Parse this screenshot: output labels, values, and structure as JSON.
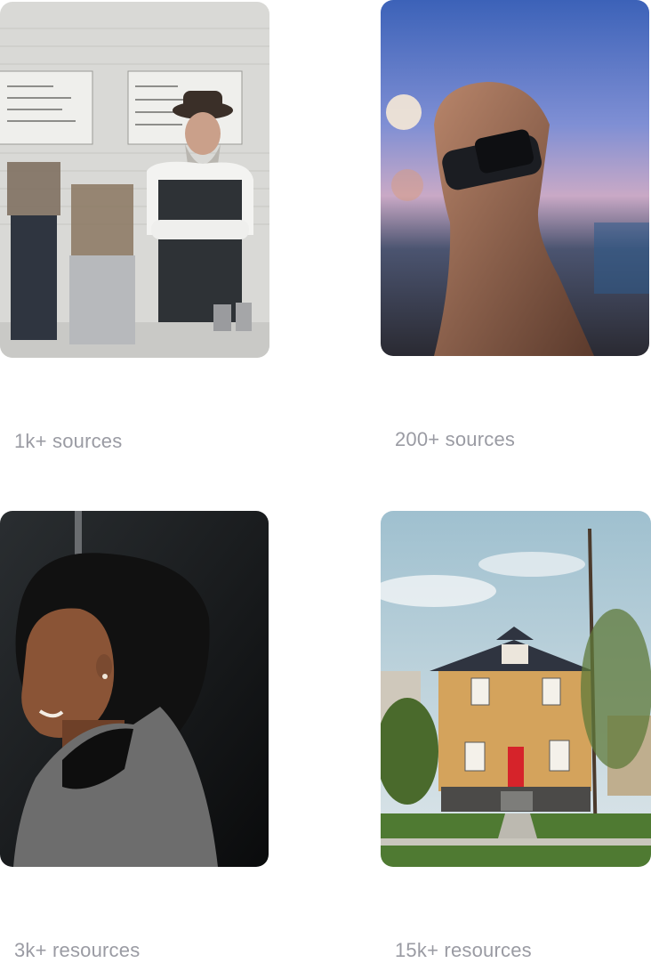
{
  "cards": [
    {
      "label": "1k+ sources",
      "image": "barista-photo"
    },
    {
      "label": "200+ sources",
      "image": "smartwatch-photo"
    },
    {
      "label": "3k+ resources",
      "image": "woman-portrait-photo"
    },
    {
      "label": "15k+ resources",
      "image": "house-photo"
    }
  ]
}
